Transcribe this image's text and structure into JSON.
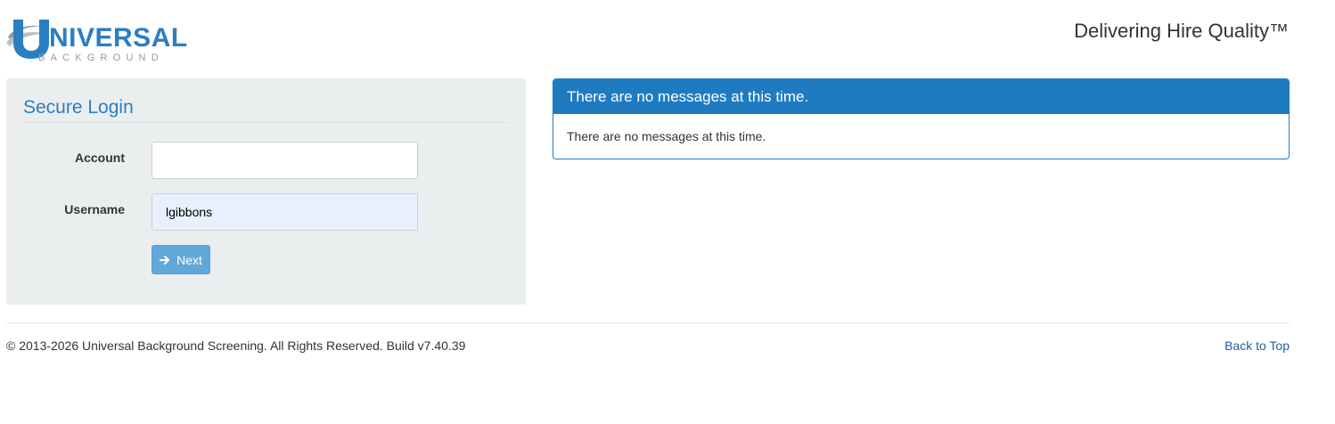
{
  "header": {
    "logo_text": "UNIVERSAL",
    "logo_subtext": "BACKGROUND",
    "tagline": "Delivering Hire Quality™"
  },
  "login": {
    "title": "Secure Login",
    "account_label": "Account",
    "account_value": "",
    "username_label": "Username",
    "username_value": "lgibbons",
    "next_label": "Next",
    "next_icon": "arrow-right-icon"
  },
  "messages": {
    "header": "There are no messages at this time.",
    "body": "There are no messages at this time."
  },
  "footer": {
    "copyright": "© 2013-2026 Universal Background Screening. All Rights Reserved. Build v7.40.39",
    "back_to_top": "Back to Top"
  },
  "colors": {
    "brand_blue": "#1f7bc1",
    "button_blue": "#62a7d9",
    "panel_gray": "#ebeeef",
    "autofill_bg": "#e8f0fe"
  }
}
